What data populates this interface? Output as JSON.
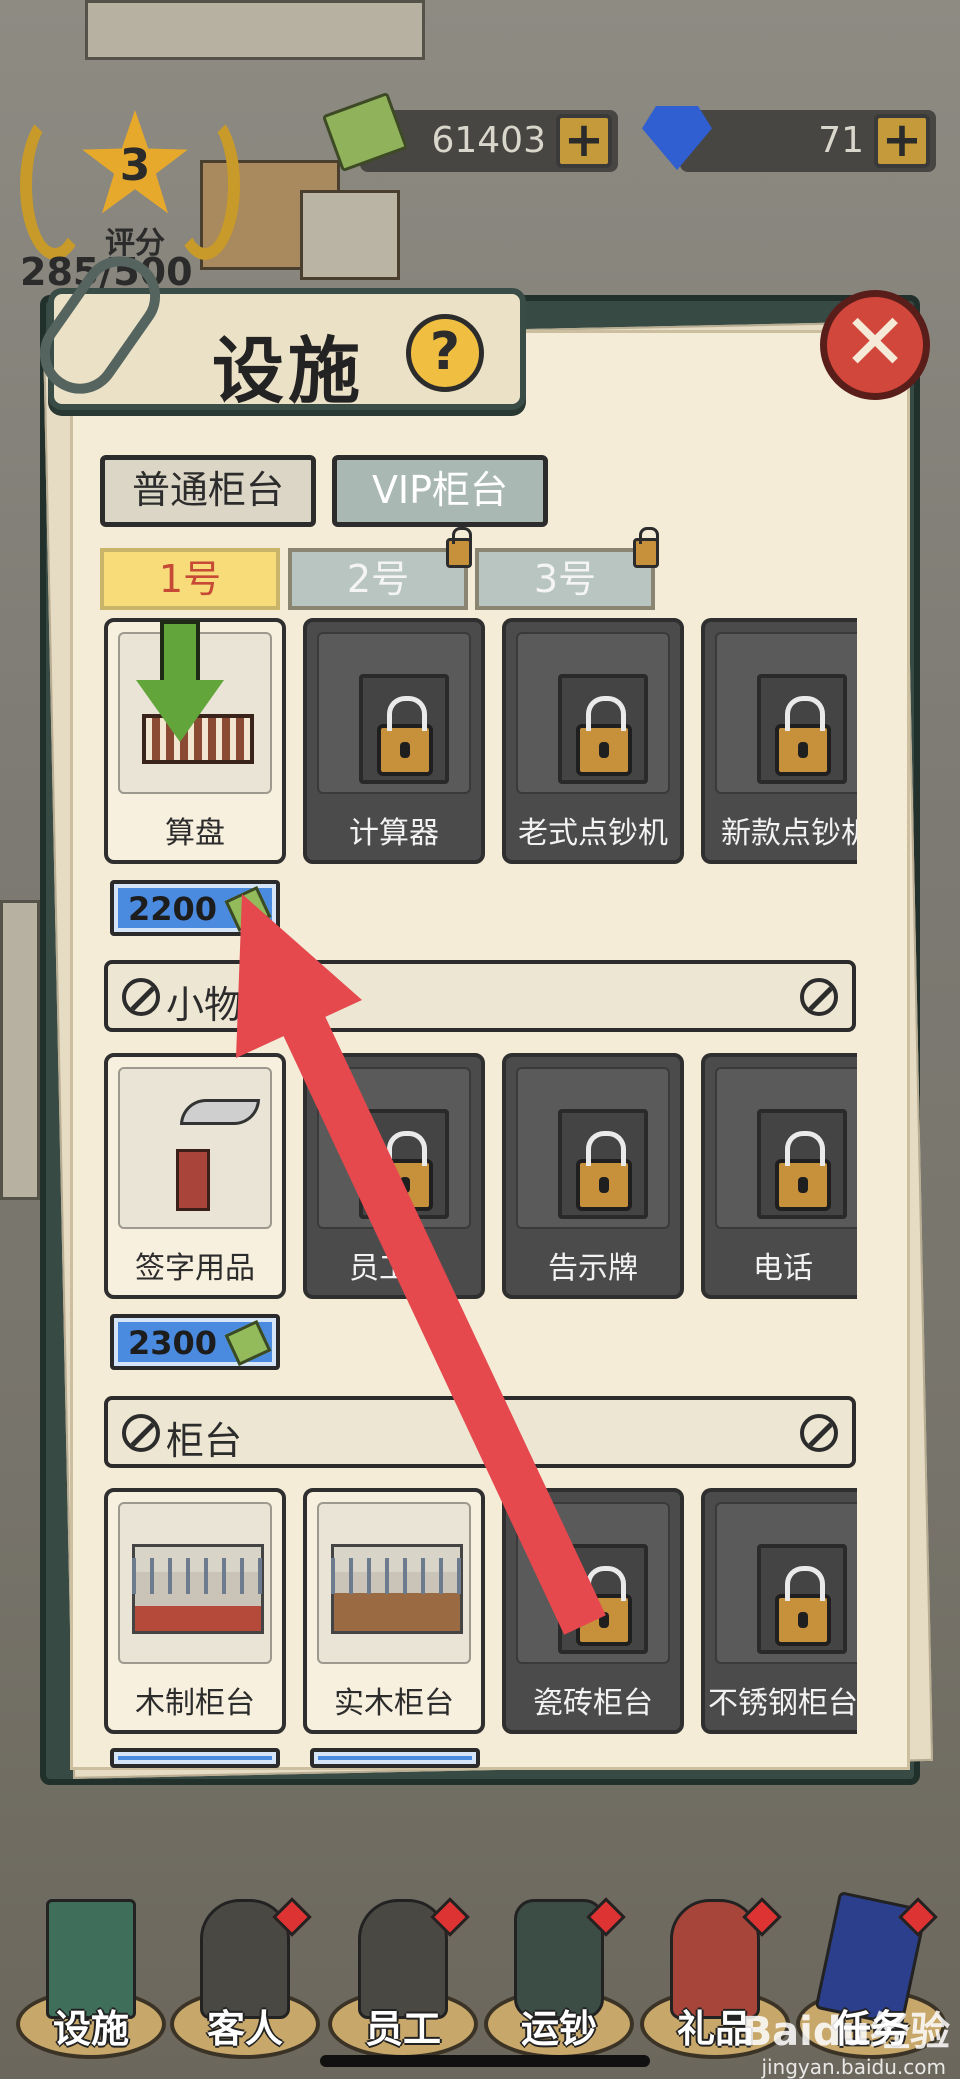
{
  "hud": {
    "level": "3",
    "rating_label": "评分",
    "rating_value": "285/500",
    "cash": "61403",
    "gems": "71",
    "plus": "+"
  },
  "modal": {
    "title": "设施",
    "help": "?",
    "close": "✕",
    "tabs": [
      "普通柜台",
      "VIP柜台"
    ],
    "counters": [
      "1号",
      "2号",
      "3号"
    ]
  },
  "rows": [
    {
      "items": [
        {
          "label": "算盘",
          "locked": false
        },
        {
          "label": "计算器",
          "locked": true
        },
        {
          "label": "老式点钞机",
          "locked": true
        },
        {
          "label": "新款点钞机",
          "locked": true
        }
      ],
      "price": "2200"
    },
    {
      "section": "小物品",
      "items": [
        {
          "label": "签字用品",
          "locked": false
        },
        {
          "label": "员工牌",
          "locked": true
        },
        {
          "label": "告示牌",
          "locked": true
        },
        {
          "label": "电话",
          "locked": true
        }
      ],
      "price": "2300"
    },
    {
      "section": "柜台",
      "items": [
        {
          "label": "木制柜台",
          "locked": false
        },
        {
          "label": "实木柜台",
          "locked": false
        },
        {
          "label": "瓷砖柜台",
          "locked": true
        },
        {
          "label": "不锈钢柜台",
          "locked": true
        }
      ]
    }
  ],
  "nav": [
    "设施",
    "客人",
    "员工",
    "运钞",
    "礼品",
    "任务"
  ],
  "watermark": "Baidu经验",
  "watermark_sub": "jingyan.baidu.com",
  "colors": {
    "accent_arrow": "#e5484d",
    "price_bg": "#4a8be0",
    "selected_tab": "#f7dc79"
  }
}
